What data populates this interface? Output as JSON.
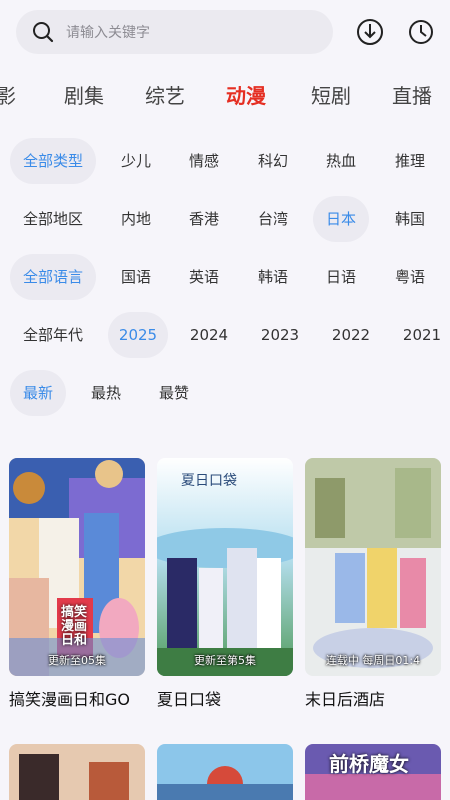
{
  "search": {
    "placeholder": "请输入关键字"
  },
  "toolbar": {
    "download_icon": "download-icon",
    "history_icon": "clock-icon"
  },
  "categories": [
    {
      "label": "影",
      "active": false
    },
    {
      "label": "剧集",
      "active": false
    },
    {
      "label": "综艺",
      "active": false
    },
    {
      "label": "动漫",
      "active": true
    },
    {
      "label": "短剧",
      "active": false
    },
    {
      "label": "直播",
      "active": false
    }
  ],
  "filters": {
    "type": [
      "全部类型",
      "少儿",
      "情感",
      "科幻",
      "热血",
      "推理"
    ],
    "region": [
      "全部地区",
      "内地",
      "香港",
      "台湾",
      "日本",
      "韩国"
    ],
    "language": [
      "全部语言",
      "国语",
      "英语",
      "韩语",
      "日语",
      "粤语"
    ],
    "year": [
      "全部年代",
      "2025",
      "2024",
      "2023",
      "2022",
      "2021"
    ],
    "sort": [
      "最新",
      "最热",
      "最赞"
    ]
  },
  "cards": [
    {
      "title": "搞笑漫画日和GO",
      "badge": "更新至05集",
      "poster_text": "搞笑漫画日和"
    },
    {
      "title": "夏日口袋",
      "badge": "更新至第5集",
      "poster_text": "夏日口袋"
    },
    {
      "title": "末日后酒店",
      "badge": "连载中 每周日01:4",
      "poster_text": ""
    }
  ],
  "cards_row2": [
    {
      "poster_text": ""
    },
    {
      "poster_text": ""
    },
    {
      "poster_text": "前桥魔女"
    }
  ],
  "colors": {
    "accent_red": "#e52e22",
    "accent_blue": "#3a8be8",
    "chip_bg": "#ebeaf1"
  }
}
